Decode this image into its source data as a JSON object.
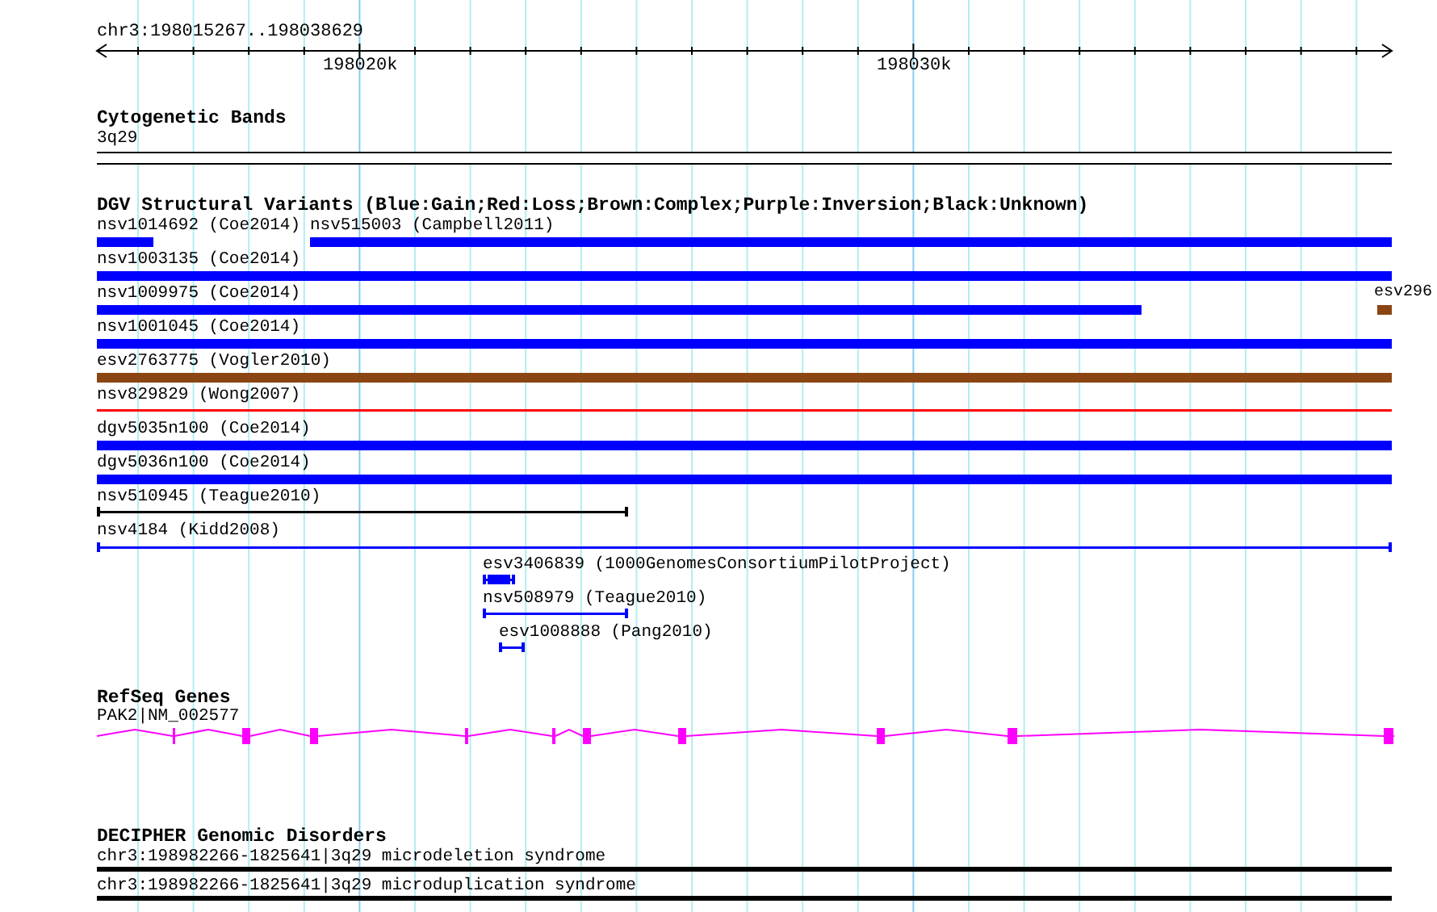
{
  "location": "chr3:198015267..198038629",
  "ruler": {
    "labels": [
      "198020k",
      "198030k"
    ]
  },
  "tracks": [
    {
      "kind": "cytoband",
      "title": "Cytogenetic Bands",
      "features": [
        {
          "label": "3q29"
        }
      ]
    },
    {
      "kind": "variants",
      "title": "DGV Structural Variants (Blue:Gain;Red:Loss;Brown:Complex;Purple:Inversion;Black:Unknown)",
      "features": [
        {
          "label": "nsv1014692 (Coe2014)",
          "kind": "block",
          "color": "#0000ff"
        },
        {
          "label": "nsv515003 (Campbell2011)",
          "kind": "block",
          "color": "#0000ff"
        },
        {
          "label": "nsv1003135 (Coe2014)",
          "kind": "block",
          "color": "#0000ff"
        },
        {
          "label": "nsv1009975 (Coe2014)",
          "kind": "block",
          "color": "#0000ff"
        },
        {
          "label": "esv296",
          "kind": "block",
          "color": "#8b4513"
        },
        {
          "label": "nsv1001045 (Coe2014)",
          "kind": "block",
          "color": "#0000ff"
        },
        {
          "label": "esv2763775 (Vogler2010)",
          "kind": "block",
          "color": "#8b4513"
        },
        {
          "label": "nsv829829 (Wong2007)",
          "kind": "line",
          "color": "#ff0000"
        },
        {
          "label": "dgv5035n100 (Coe2014)",
          "kind": "block",
          "color": "#0000ff"
        },
        {
          "label": "dgv5036n100 (Coe2014)",
          "kind": "block",
          "color": "#0000ff"
        },
        {
          "label": "nsv510945 (Teague2010)",
          "kind": "capped-line",
          "color": "#000000"
        },
        {
          "label": "nsv4184 (Kidd2008)",
          "kind": "capped-line",
          "color": "#0000ff"
        },
        {
          "label": "esv3406839 (1000GenomesConsortiumPilotProject)",
          "kind": "capped-block",
          "color": "#0000ff"
        },
        {
          "label": "nsv508979 (Teague2010)",
          "kind": "capped-line",
          "color": "#0000ff"
        },
        {
          "label": "esv1008888 (Pang2010)",
          "kind": "capped-line",
          "color": "#0000ff"
        }
      ]
    },
    {
      "kind": "genes",
      "title": "RefSeq Genes",
      "features": [
        {
          "label": "PAK2|NM_002577"
        }
      ]
    },
    {
      "kind": "disorders",
      "title": "DECIPHER Genomic Disorders",
      "features": [
        {
          "label": "chr3:198982266-1825641|3q29 microdeletion syndrome"
        },
        {
          "label": "chr3:198982266-1825641|3q29 microduplication syndrome"
        }
      ]
    }
  ]
}
